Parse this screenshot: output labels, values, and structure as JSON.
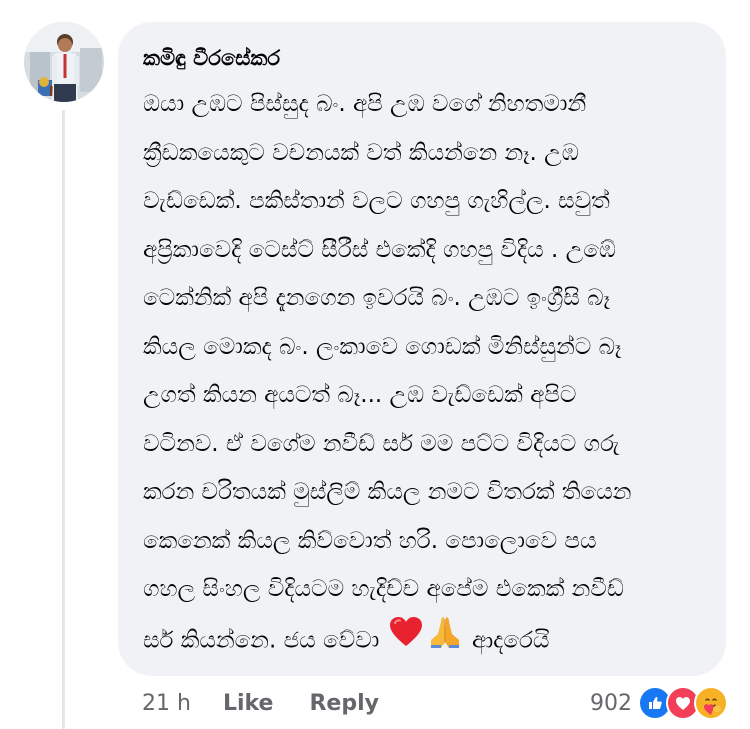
{
  "comment": {
    "author": "කමිඳු වීරසේකර",
    "lines": [
      "ඔයා උඹට පිස්සුද බං. අපි උඹ වගේ නිහතමානී",
      "ක්‍රීඩකයෙකුට වචනයක් වත් කියන්නෙ නෑ. උඹ",
      "වැඩ්ඩෙක්. පකිස්තාන් වලට ගහපු ගැහිල්ල. සවුත්",
      "අප්‍රිකාවෙදි ටෙස්ට් සීරීස් එකේදි ගහපු විදිය . උඹේ",
      "ටෙක්නික් අපි දැනගෙන ඉවරයි බං. උඹට ඉංග්‍රීසි බෑ",
      "කියල මොකද බං. ලංකාවෙ ගොඩක් මිනිස්සුන්ට බෑ",
      "උගත් කියන අයටත් බෑ... උඹ වැඩ්ඩෙක් අපිට",
      "වටිනව. ඒ වගේම නවීඩ් සර් මම පට්ට විදියට ගරු",
      "කරන චරිතයක් මුස්ලිම් කියල නමට විතරක් තියෙන",
      "කෙනෙක් කියල කිව්වොත් හරි. පොලොවෙ පය",
      "ගහල සිංහල විදියටම හැදිච්ච අපේම එකෙක් නවීඩ්"
    ],
    "last_line_start": "සර් කියන්නෙ. ජය වේවා",
    "last_line_end": "ආදරෙයි",
    "emojis": [
      "red-heart-icon",
      "folded-hands-icon"
    ]
  },
  "footer": {
    "time": "21 h",
    "like_label": "Like",
    "reply_label": "Reply"
  },
  "reactions": {
    "count": "902",
    "icons": [
      "like-icon",
      "love-icon",
      "care-icon"
    ]
  },
  "colors": {
    "bubble_bg": "#f0f2f5",
    "text": "#050505",
    "muted": "#65676b",
    "like_blue": "#1877f2",
    "love_red": "#f33e58",
    "care_yellow": "#f7b125"
  }
}
